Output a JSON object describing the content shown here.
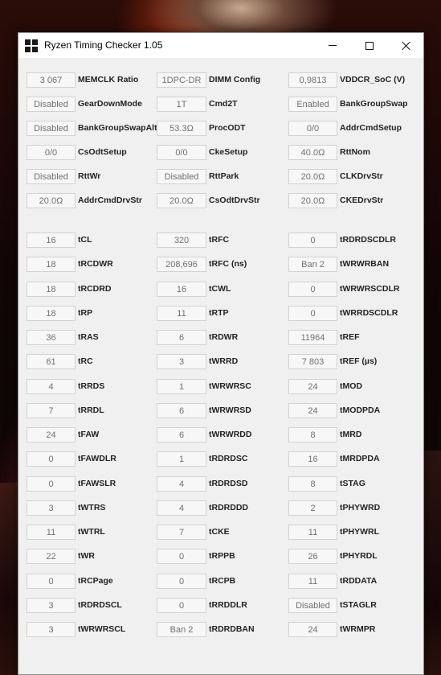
{
  "window": {
    "title": "Ryzen Timing Checker 1.05"
  },
  "top_rows": [
    [
      {
        "value": "3 067",
        "label": "MEMCLK Ratio"
      },
      {
        "value": "1DPC-DR",
        "label": "DIMM Config"
      },
      {
        "value": "0,9813",
        "label": "VDDCR_SoC (V)"
      }
    ],
    [
      {
        "value": "Disabled",
        "label": "GearDownMode"
      },
      {
        "value": "1T",
        "label": "Cmd2T"
      },
      {
        "value": "Enabled",
        "label": "BankGroupSwap"
      }
    ],
    [
      {
        "value": "Disabled",
        "label": "BankGroupSwapAlt"
      },
      {
        "value": "53.3Ω",
        "label": "ProcODT"
      },
      {
        "value": "0/0",
        "label": "AddrCmdSetup"
      }
    ],
    [
      {
        "value": "0/0",
        "label": "CsOdtSetup"
      },
      {
        "value": "0/0",
        "label": "CkeSetup"
      },
      {
        "value": "40.0Ω",
        "label": "RttNom"
      }
    ],
    [
      {
        "value": "Disabled",
        "label": "RttWr"
      },
      {
        "value": "Disabled",
        "label": "RttPark"
      },
      {
        "value": "20.0Ω",
        "label": "CLKDrvStr"
      }
    ],
    [
      {
        "value": "20.0Ω",
        "label": "AddrCmdDrvStr"
      },
      {
        "value": "20.0Ω",
        "label": "CsOdtDrvStr"
      },
      {
        "value": "20.0Ω",
        "label": "CKEDrvStr"
      }
    ]
  ],
  "timing_rows": [
    [
      {
        "value": "16",
        "label": "tCL"
      },
      {
        "value": "320",
        "label": "tRFC"
      },
      {
        "value": "0",
        "label": "tRDRDSCDLR"
      }
    ],
    [
      {
        "value": "18",
        "label": "tRCDWR"
      },
      {
        "value": "208,696",
        "label": "tRFC (ns)"
      },
      {
        "value": "Ban 2",
        "label": "tWRWRBAN"
      }
    ],
    [
      {
        "value": "18",
        "label": "tRCDRD"
      },
      {
        "value": "16",
        "label": "tCWL"
      },
      {
        "value": "0",
        "label": "tWRWRSCDLR"
      }
    ],
    [
      {
        "value": "18",
        "label": "tRP"
      },
      {
        "value": "11",
        "label": "tRTP"
      },
      {
        "value": "0",
        "label": "tWRRDSCDLR"
      }
    ],
    [
      {
        "value": "36",
        "label": "tRAS"
      },
      {
        "value": "6",
        "label": "tRDWR"
      },
      {
        "value": "11964",
        "label": "tREF"
      }
    ],
    [
      {
        "value": "61",
        "label": "tRC"
      },
      {
        "value": "3",
        "label": "tWRRD"
      },
      {
        "value": "7 803",
        "label": "tREF (µs)"
      }
    ],
    [
      {
        "value": "4",
        "label": "tRRDS"
      },
      {
        "value": "1",
        "label": "tWRWRSC"
      },
      {
        "value": "24",
        "label": "tMOD"
      }
    ],
    [
      {
        "value": "7",
        "label": "tRRDL"
      },
      {
        "value": "6",
        "label": "tWRWRSD"
      },
      {
        "value": "24",
        "label": "tMODPDA"
      }
    ],
    [
      {
        "value": "24",
        "label": "tFAW"
      },
      {
        "value": "6",
        "label": "tWRWRDD"
      },
      {
        "value": "8",
        "label": "tMRD"
      }
    ],
    [
      {
        "value": "0",
        "label": "tFAWDLR"
      },
      {
        "value": "1",
        "label": "tRDRDSC"
      },
      {
        "value": "16",
        "label": "tMRDPDA"
      }
    ],
    [
      {
        "value": "0",
        "label": "tFAWSLR"
      },
      {
        "value": "4",
        "label": "tRDRDSD"
      },
      {
        "value": "8",
        "label": "tSTAG"
      }
    ],
    [
      {
        "value": "3",
        "label": "tWTRS"
      },
      {
        "value": "4",
        "label": "tRDRDDD"
      },
      {
        "value": "2",
        "label": "tPHYWRD"
      }
    ],
    [
      {
        "value": "11",
        "label": "tWTRL"
      },
      {
        "value": "7",
        "label": "tCKE"
      },
      {
        "value": "11",
        "label": "tPHYWRL"
      }
    ],
    [
      {
        "value": "22",
        "label": "tWR"
      },
      {
        "value": "0",
        "label": "tRPPB"
      },
      {
        "value": "26",
        "label": "tPHYRDL"
      }
    ],
    [
      {
        "value": "0",
        "label": "tRCPage"
      },
      {
        "value": "0",
        "label": "tRCPB"
      },
      {
        "value": "11",
        "label": "tRDDATA"
      }
    ],
    [
      {
        "value": "3",
        "label": "tRDRDSCL"
      },
      {
        "value": "0",
        "label": "tRRDDLR"
      },
      {
        "value": "Disabled",
        "label": "tSTAGLR"
      }
    ],
    [
      {
        "value": "3",
        "label": "tWRWRSCL"
      },
      {
        "value": "Ban 2",
        "label": "tRDRDBAN"
      },
      {
        "value": "24",
        "label": "tWRMPR"
      }
    ]
  ]
}
